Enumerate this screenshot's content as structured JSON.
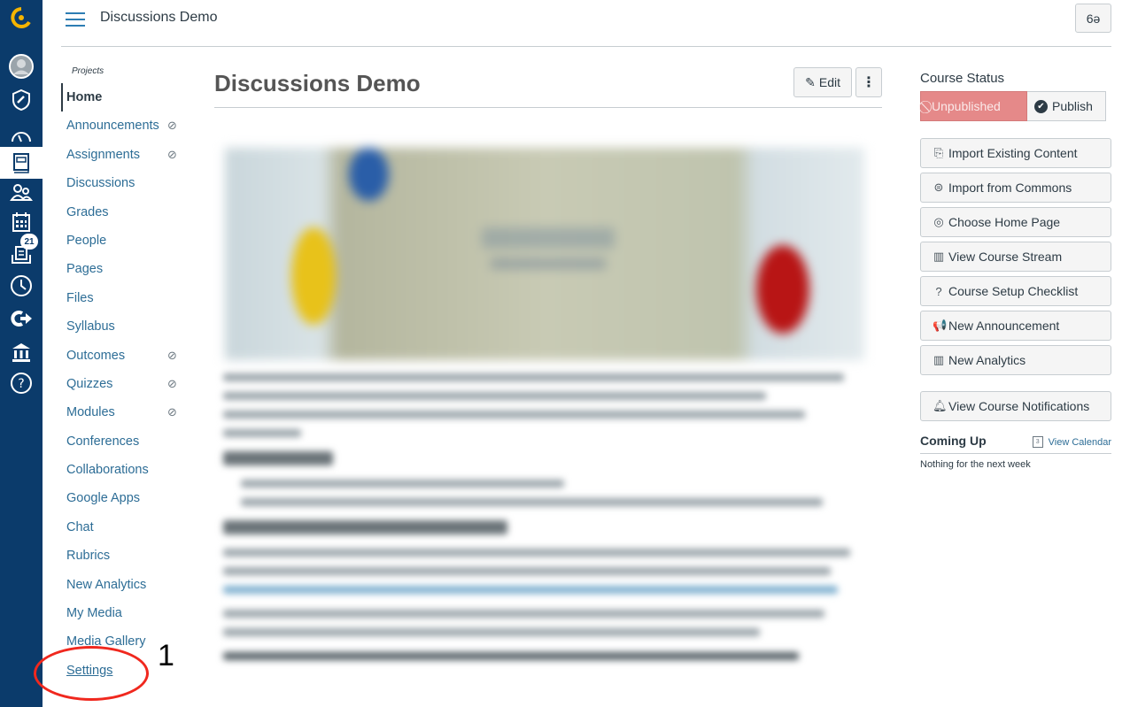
{
  "header": {
    "breadcrumb": "Discussions Demo",
    "immersive_reader_icon": "glasses-icon"
  },
  "global_nav": {
    "items": [
      {
        "name": "logo",
        "icon": "institution-logo-icon"
      },
      {
        "name": "account",
        "icon": "avatar-icon"
      },
      {
        "name": "admin",
        "icon": "shield-icon"
      },
      {
        "name": "dashboard",
        "icon": "dashboard-icon"
      },
      {
        "name": "courses",
        "icon": "book-icon",
        "active": true
      },
      {
        "name": "groups",
        "icon": "people-icon"
      },
      {
        "name": "calendar",
        "icon": "calendar-icon"
      },
      {
        "name": "inbox",
        "icon": "inbox-icon",
        "badge": "21"
      },
      {
        "name": "history",
        "icon": "clock-icon"
      },
      {
        "name": "commons",
        "icon": "commons-arrow-icon"
      },
      {
        "name": "institution",
        "icon": "building-icon"
      },
      {
        "name": "help",
        "icon": "help-icon"
      }
    ]
  },
  "course_nav": {
    "title": "Projects",
    "items": [
      {
        "label": "Home",
        "active": true,
        "hidden": false
      },
      {
        "label": "Announcements",
        "hidden": true
      },
      {
        "label": "Assignments",
        "hidden": true
      },
      {
        "label": "Discussions",
        "hidden": false
      },
      {
        "label": "Grades",
        "hidden": false
      },
      {
        "label": "People",
        "hidden": false
      },
      {
        "label": "Pages",
        "hidden": false
      },
      {
        "label": "Files",
        "hidden": false
      },
      {
        "label": "Syllabus",
        "hidden": false
      },
      {
        "label": "Outcomes",
        "hidden": true
      },
      {
        "label": "Quizzes",
        "hidden": true
      },
      {
        "label": "Modules",
        "hidden": true
      },
      {
        "label": "Conferences",
        "hidden": false
      },
      {
        "label": "Collaborations",
        "hidden": false
      },
      {
        "label": "Google Apps",
        "hidden": false
      },
      {
        "label": "Chat",
        "hidden": false
      },
      {
        "label": "Rubrics",
        "hidden": false
      },
      {
        "label": "New Analytics",
        "hidden": false
      },
      {
        "label": "My Media",
        "hidden": false
      },
      {
        "label": "Media Gallery",
        "hidden": false
      },
      {
        "label": "Settings",
        "hidden": false
      }
    ]
  },
  "main": {
    "title": "Discussions Demo",
    "edit_label": "Edit",
    "kebab_label": "⋮",
    "content_blurred": true
  },
  "sidebar": {
    "course_status_heading": "Course Status",
    "unpublished_label": "Unpublished",
    "publish_label": "Publish",
    "actions": [
      {
        "label": "Import Existing Content",
        "icon": "import-icon",
        "glyph": "⎘"
      },
      {
        "label": "Import from Commons",
        "icon": "commons-icon",
        "glyph": "⊜"
      },
      {
        "label": "Choose Home Page",
        "icon": "target-icon",
        "glyph": "◎"
      },
      {
        "label": "View Course Stream",
        "icon": "stats-icon",
        "glyph": "▥"
      },
      {
        "label": "Course Setup Checklist",
        "icon": "question-icon",
        "glyph": "?"
      },
      {
        "label": "New Announcement",
        "icon": "megaphone-icon",
        "glyph": "📢"
      },
      {
        "label": "New Analytics",
        "icon": "stats-icon",
        "glyph": "▥"
      }
    ],
    "notifications_label": "View Course Notifications",
    "coming_up_heading": "Coming Up",
    "view_calendar_label": "View Calendar",
    "calendar_icon_day": "3",
    "nothing_text": "Nothing for the next week"
  },
  "annotation": {
    "number": "1",
    "color": "#f0281e",
    "target": "Settings"
  },
  "colors": {
    "global_nav_bg": "#0b3b6b",
    "link": "#2d6d96",
    "unpublished_bg": "#e58989",
    "logo_accent": "#f5b400"
  }
}
